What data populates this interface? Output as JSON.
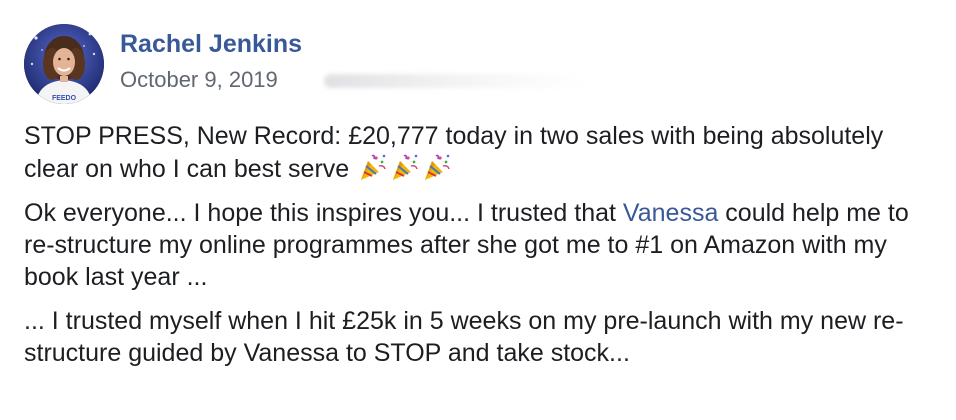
{
  "post": {
    "author": "Rachel Jenkins",
    "date": "October 9, 2019",
    "avatar_shirt_text": "FEEDO",
    "paragraphs": [
      {
        "text": "STOP PRESS, New Record: £20,777 today in two sales with being absolutely clear on who I can best serve",
        "emojis": [
          "party-popper-icon",
          "party-popper-icon",
          "party-popper-icon"
        ]
      },
      {
        "before_mention": "Ok everyone... I hope this inspires you... I trusted that ",
        "mention": "Vanessa",
        "after_mention": " could help me to re-structure my online programmes after she got me to #1 on Amazon with my book last year ..."
      },
      {
        "text": "... I trusted myself when I hit £25k in 5 weeks on my pre-launch with my new re-structure guided by Vanessa to STOP and take stock..."
      }
    ]
  },
  "colors": {
    "author_link": "#385898",
    "mention_link": "#385898",
    "date_text": "#616770",
    "body_text": "#1c1e21"
  }
}
